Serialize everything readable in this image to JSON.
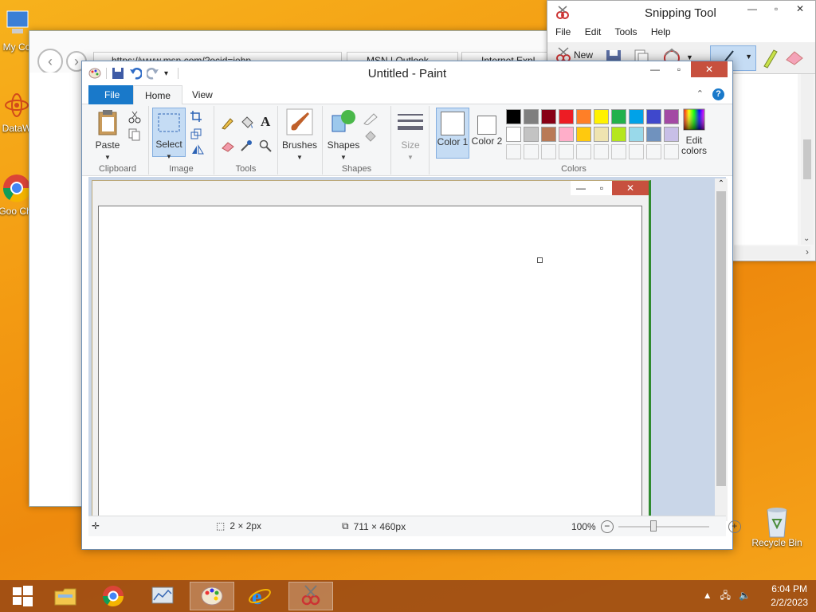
{
  "desktop": {
    "icons": [
      {
        "label": "My Co"
      },
      {
        "label": "DataW"
      },
      {
        "label": "Goo Chr"
      },
      {
        "label": "Recycle Bin"
      }
    ]
  },
  "ie": {
    "address": "https://www.msn.com/?ocid=iehp",
    "tab1": "MSN | Outlook",
    "tab2": "Internet Expl"
  },
  "snipping_tool": {
    "title": "Snipping Tool",
    "menu": [
      "File",
      "Edit",
      "Tools",
      "Help"
    ],
    "new_label": "New"
  },
  "paint": {
    "title": "Untitled - Paint",
    "tabs": {
      "file": "File",
      "home": "Home",
      "view": "View"
    },
    "groups": {
      "clipboard": "Clipboard",
      "image": "Image",
      "tools": "Tools",
      "shapes": "Shapes",
      "colors": "Colors"
    },
    "buttons": {
      "paste": "Paste",
      "select": "Select",
      "brushes": "Brushes",
      "shapes": "Shapes",
      "size": "Size",
      "color1": "Color 1",
      "color2": "Color 2",
      "edit_colors": "Edit colors"
    },
    "palette_row1": [
      "#000000",
      "#7f7f7f",
      "#880015",
      "#ed1c24",
      "#ff7f27",
      "#fff200",
      "#22b14c",
      "#00a2e8",
      "#3f48cc",
      "#a349a4"
    ],
    "palette_row2": [
      "#ffffff",
      "#c3c3c3",
      "#b97a57",
      "#ffaec9",
      "#ffc90e",
      "#efe4b0",
      "#b5e61d",
      "#99d9ea",
      "#7092be",
      "#c8bfe7"
    ],
    "status": {
      "selection": "2 × 2px",
      "canvas_size": "711 × 460px",
      "zoom": "100%"
    }
  },
  "taskbar": {
    "time": "6:04 PM",
    "date": "2/2/2023"
  }
}
